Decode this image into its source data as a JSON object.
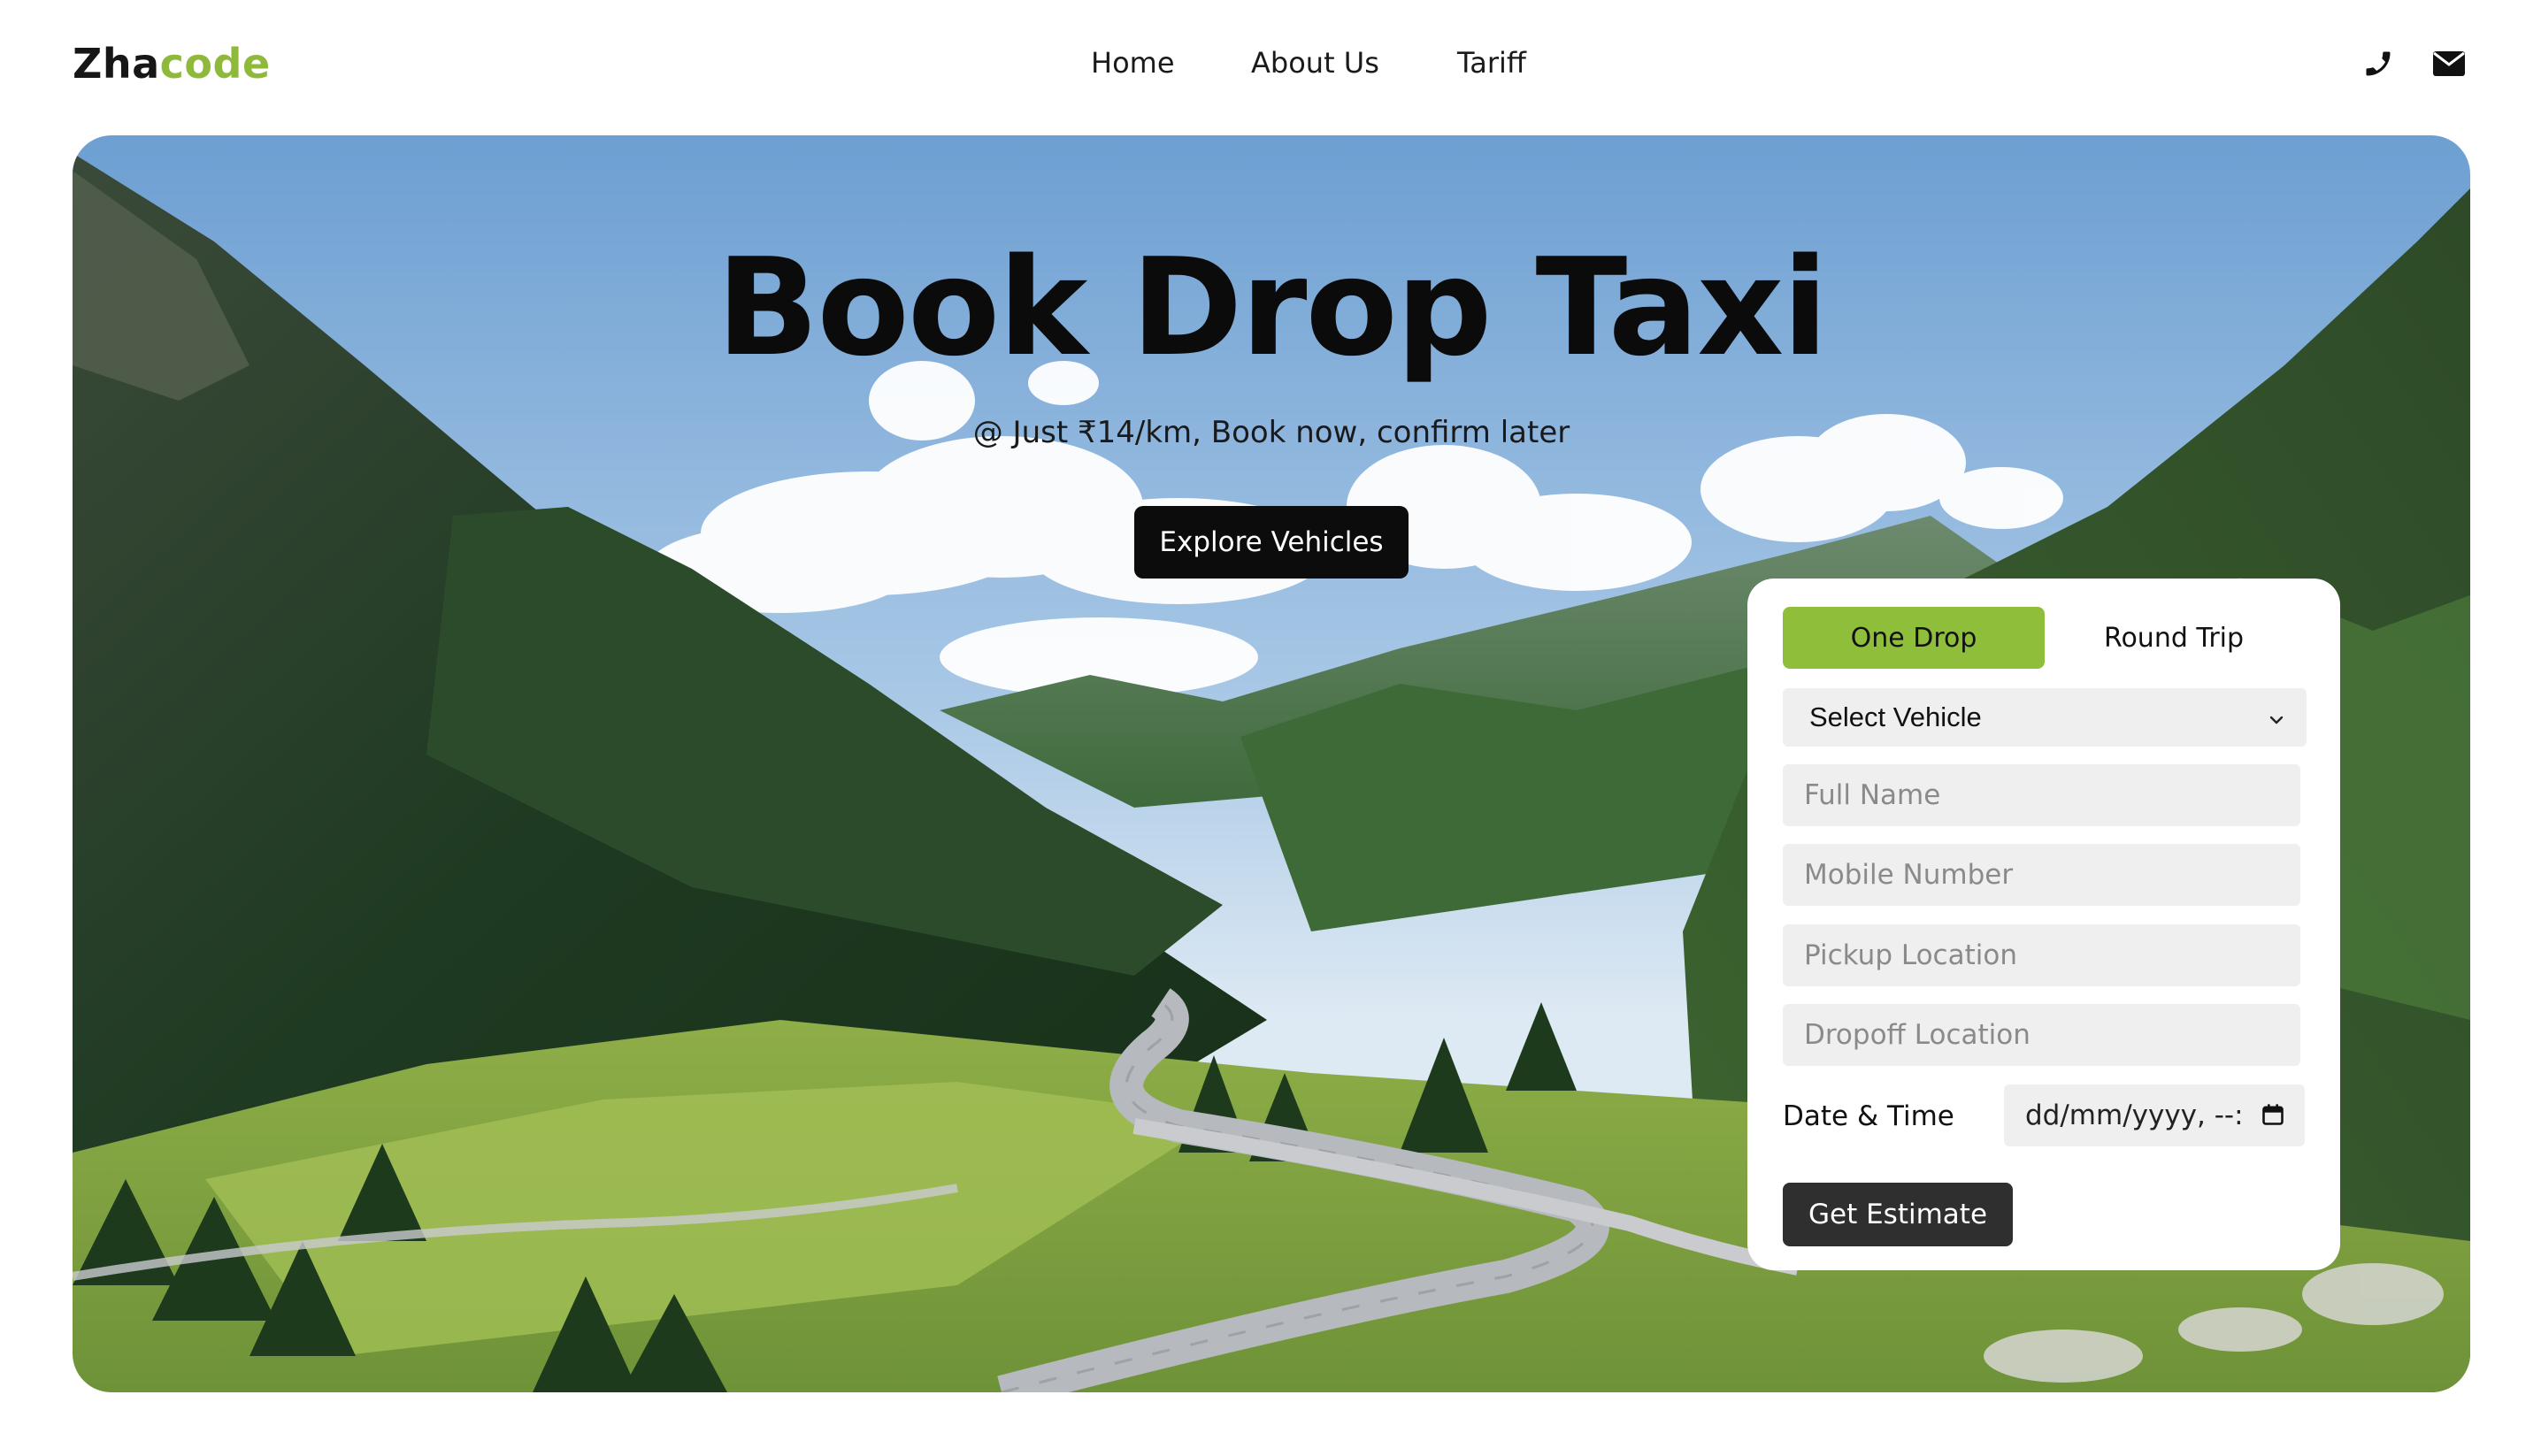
{
  "brand": {
    "part1": "Zha",
    "part2": "code",
    "accent_color": "#8fb93a"
  },
  "nav": {
    "items": [
      {
        "label": "Home"
      },
      {
        "label": "About Us"
      },
      {
        "label": "Tariff"
      }
    ],
    "icons": [
      "phone-icon",
      "mail-icon"
    ]
  },
  "hero": {
    "title": "Book Drop Taxi",
    "subtitle": "@ Just ₹14/km, Book now, confirm later",
    "cta_label": "Explore Vehicles",
    "background": "mountain-valley-road-photo"
  },
  "booking": {
    "tabs": [
      {
        "label": "One Drop",
        "active": true
      },
      {
        "label": "Round Trip",
        "active": false
      }
    ],
    "vehicle_select": {
      "value": "Select Vehicle"
    },
    "fields": {
      "full_name": {
        "placeholder": "Full Name",
        "value": ""
      },
      "mobile": {
        "placeholder": "Mobile Number",
        "value": ""
      },
      "pickup": {
        "placeholder": "Pickup Location",
        "value": ""
      },
      "dropoff": {
        "placeholder": "Dropoff Location",
        "value": ""
      }
    },
    "datetime": {
      "label": "Date & Time",
      "value": "dd/mm/yyyy, --:"
    },
    "submit_label": "Get Estimate",
    "active_tab_color": "#8fbf3a",
    "submit_color": "#2f2f2f"
  }
}
